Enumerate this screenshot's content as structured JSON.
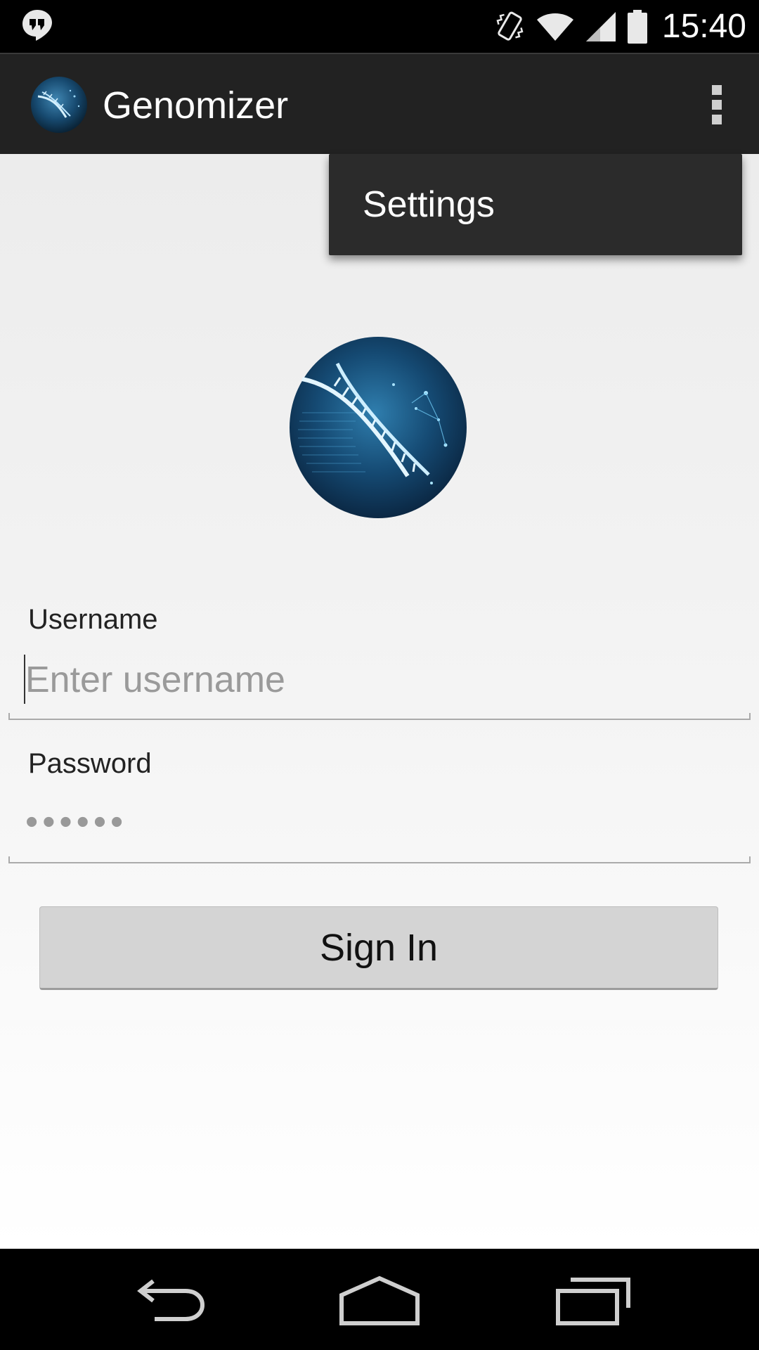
{
  "status_bar": {
    "time": "15:40",
    "icons": [
      "hangouts-icon",
      "vibrate-icon",
      "wifi-icon",
      "signal-icon",
      "battery-icon"
    ]
  },
  "action_bar": {
    "title": "Genomizer",
    "app_icon": "dna-globe-icon",
    "overflow_icon": "overflow-menu-icon"
  },
  "menu": {
    "items": [
      {
        "label": "Settings"
      }
    ]
  },
  "login": {
    "logo": "dna-globe-logo",
    "username_label": "Username",
    "username_placeholder": "Enter username",
    "username_value": "",
    "password_label": "Password",
    "password_value": "••••••",
    "signin_label": "Sign In"
  },
  "nav_bar": {
    "icons": [
      "back-icon",
      "home-icon",
      "recents-icon"
    ]
  },
  "colors": {
    "status_bar": "#000000",
    "action_bar": "#222222",
    "menu_bg": "#2b2b2b",
    "button_bg": "#d4d4d4",
    "logo_primary": "#0f3552",
    "logo_accent": "#7fd4f4"
  }
}
